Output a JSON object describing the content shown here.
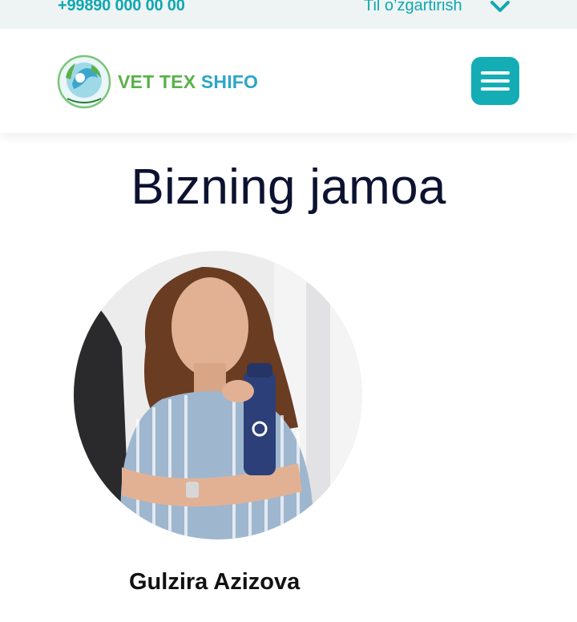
{
  "topbar": {
    "phone": "+99890 000 00 00",
    "language_label": "Til o’zgartirish",
    "language_icon": "chevron-down-icon"
  },
  "header": {
    "logo_text_part1": "VET TEX ",
    "logo_text_part2": "SHIFO",
    "logo_icon": "vet-emblem-icon",
    "menu_icon": "hamburger-icon"
  },
  "colors": {
    "accent": "#14adb5",
    "logo_green": "#5bb04a",
    "logo_blue": "#2ba6c8",
    "title": "#0d1230"
  },
  "main": {
    "title": "Bizning jamoa",
    "team": [
      {
        "name": "Gulzira Azizova"
      }
    ]
  }
}
